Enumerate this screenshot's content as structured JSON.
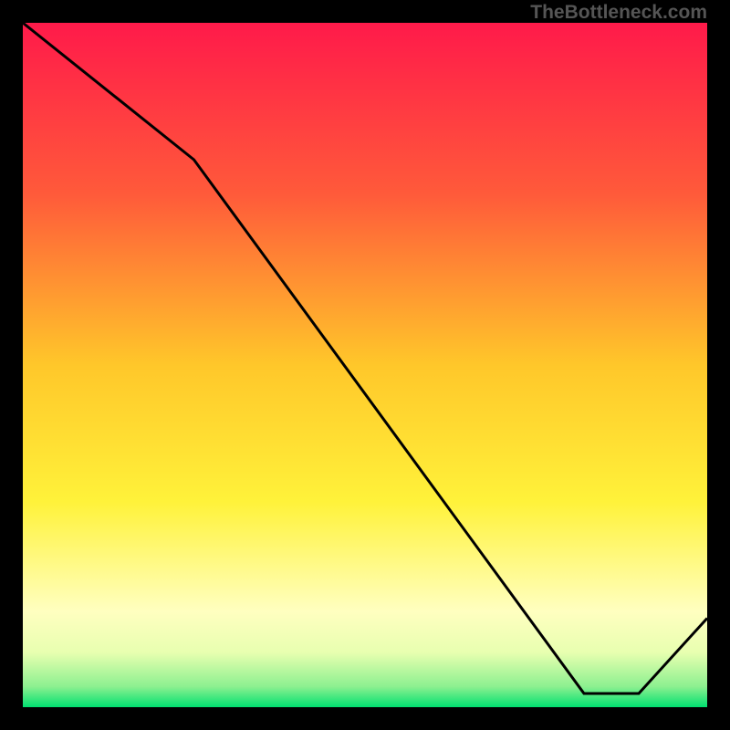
{
  "watermark": "TheBottleneck.com",
  "small_label": "",
  "chart_data": {
    "type": "line",
    "title": "",
    "xlabel": "",
    "ylabel": "",
    "xlim": [
      0,
      100
    ],
    "ylim": [
      0,
      100
    ],
    "x": [
      0,
      25,
      82,
      90,
      100
    ],
    "values": [
      100,
      80,
      2,
      2,
      13
    ],
    "gradient_stops": [
      {
        "offset": 0,
        "color": "#ff1a4a"
      },
      {
        "offset": 25,
        "color": "#ff5a3a"
      },
      {
        "offset": 50,
        "color": "#ffc72a"
      },
      {
        "offset": 70,
        "color": "#fff23a"
      },
      {
        "offset": 86,
        "color": "#ffffc0"
      },
      {
        "offset": 92,
        "color": "#e8ffb0"
      },
      {
        "offset": 97,
        "color": "#8cf090"
      },
      {
        "offset": 100,
        "color": "#00e070"
      }
    ],
    "line_color": "#000000",
    "line_width": 3
  }
}
